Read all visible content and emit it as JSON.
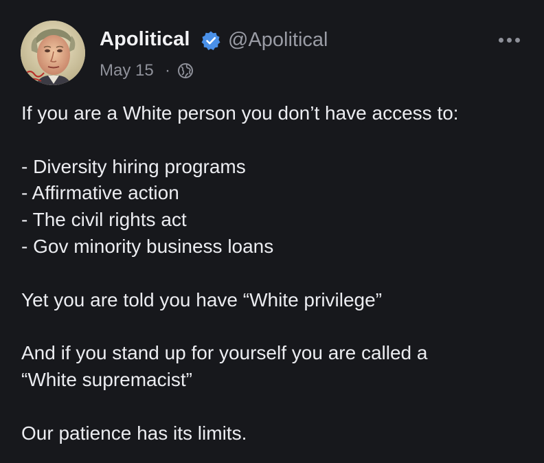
{
  "post": {
    "author_name": "Apolitical",
    "handle": "@Apolitical",
    "verified": true,
    "date": "May 15",
    "separator": "·",
    "visibility_icon": "globe-icon",
    "more_icon": "more-horizontal-icon",
    "avatar_signature": "Maybe Hangers",
    "lines": [
      "If you are a White person you don’t have access to:",
      "- Diversity hiring programs",
      "- Affirmative action",
      "- The civil rights act",
      "- Gov minority business loans",
      "Yet you are told you have “White privilege”",
      "And if you stand up for yourself you are called a",
      "“White supremacist”",
      "Our patience has its limits."
    ]
  },
  "colors": {
    "background": "#17181c",
    "text_primary": "#ecedf1",
    "text_secondary": "#8f919a",
    "verified_badge": "#4a90e8"
  }
}
